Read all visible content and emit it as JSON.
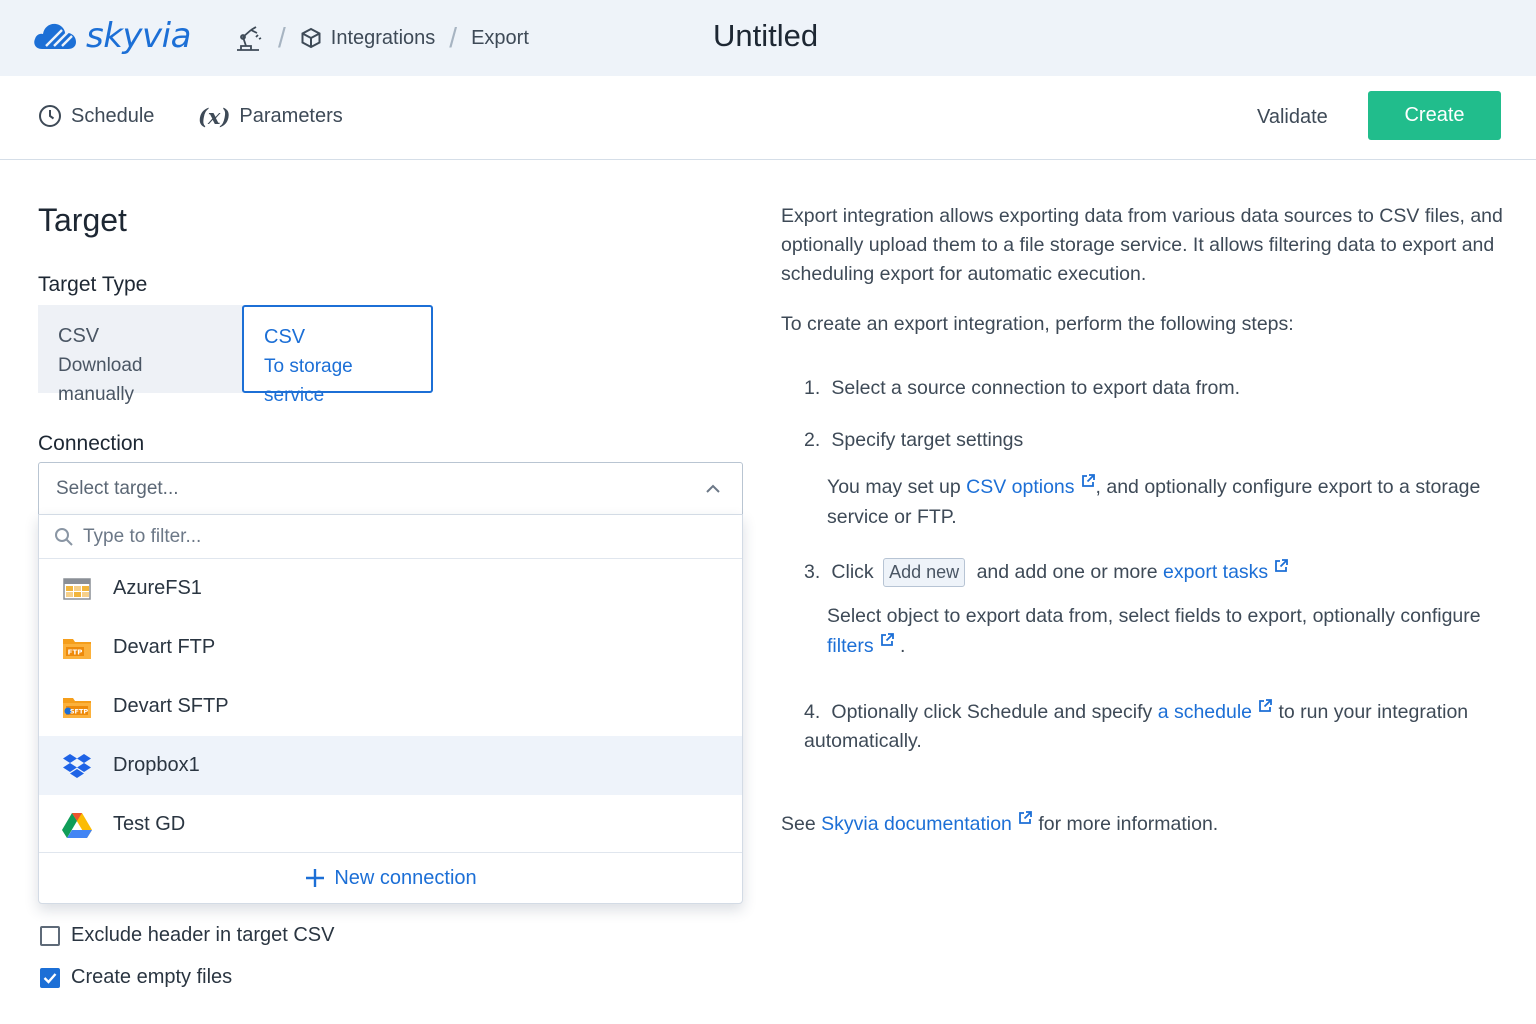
{
  "app": {
    "brand": "skyvia",
    "brand_color": "#1c6fd6",
    "accent_color": "#21bd8c"
  },
  "breadcrumb": {
    "items": [
      {
        "icon": "robot-arm-icon"
      },
      {
        "icon": "cube-icon",
        "label": "Integrations"
      },
      {
        "label": "Export"
      }
    ]
  },
  "page": {
    "title": "Untitled"
  },
  "toolbar": {
    "schedule_label": "Schedule",
    "parameters_label": "Parameters",
    "parameters_glyph": "(x)",
    "validate_label": "Validate",
    "create_label": "Create"
  },
  "target": {
    "title": "Target",
    "type_label": "Target Type",
    "types": [
      {
        "line1": "CSV",
        "line2": "Download manually",
        "selected": false
      },
      {
        "line1": "CSV",
        "line2": "To storage service",
        "selected": true
      }
    ],
    "connection_label": "Connection",
    "select_placeholder": "Select target...",
    "filter_placeholder": "Type to filter...",
    "connections": [
      {
        "name": "AzureFS1",
        "icon": "azure-file-storage-icon"
      },
      {
        "name": "Devart FTP",
        "icon": "ftp-folder-icon"
      },
      {
        "name": "Devart SFTP",
        "icon": "sftp-folder-icon"
      },
      {
        "name": "Dropbox1",
        "icon": "dropbox-icon",
        "highlighted": true
      },
      {
        "name": "Test GD",
        "icon": "google-drive-icon"
      }
    ],
    "new_connection_label": "New connection",
    "exclude_header_label": "Exclude header in target CSV",
    "exclude_header_checked": false,
    "create_empty_label": "Create empty files",
    "create_empty_checked": true
  },
  "help": {
    "intro": "Export integration allows exporting data from various data sources to CSV files, and optionally upload them to a file storage service. It allows filtering data to export and scheduling export for automatic execution.",
    "steps_intro": "To create an export integration, perform the following steps:",
    "step1": {
      "num": "1.",
      "text": "Select a source connection to export data from."
    },
    "step2": {
      "num": "2.",
      "text": "Specify target settings",
      "sub_before": "You may set up",
      "sub_link": "CSV options",
      "sub_after": ", and optionally configure export to a storage service or FTP."
    },
    "step3": {
      "num": "3.",
      "click": "Click",
      "chip": "Add new",
      "middle": "and add one or more",
      "link": "export tasks",
      "sub_text": "Select object to export data from, select fields to export, optionally configure",
      "sub_link": "filters",
      "sub_end": "."
    },
    "step4": {
      "num": "4.",
      "before": "Optionally click Schedule and specify",
      "link": "a schedule",
      "after": "to run your integration automatically."
    },
    "footer_before": "See",
    "footer_link": "Skyvia documentation",
    "footer_after": "for more information."
  }
}
